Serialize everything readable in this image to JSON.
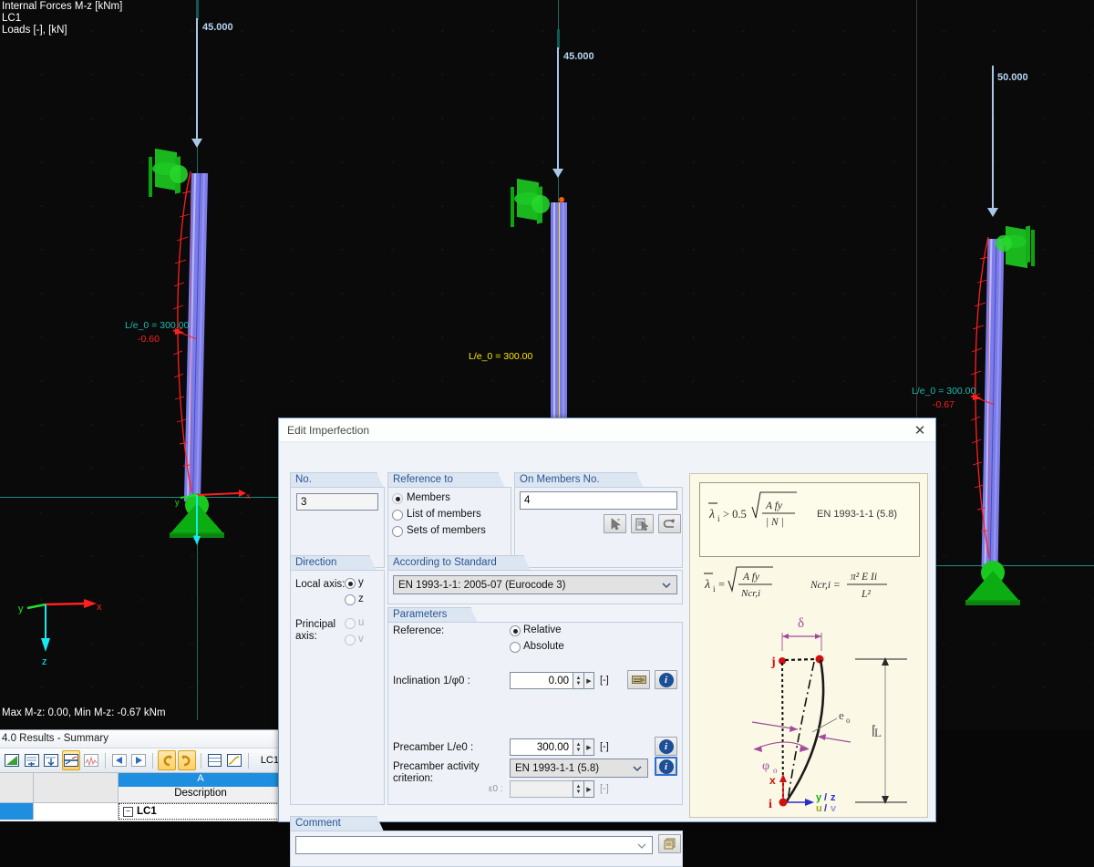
{
  "viewport": {
    "overlay_text_lines": [
      "Internal Forces M-z [kNm]",
      "LC1",
      "Loads [-], [kN]"
    ],
    "status_text": "Max M-z: 0.00, Min M-z: -0.67 kNm",
    "axis_triad": {
      "x": "x",
      "y": "y",
      "z": "z"
    },
    "columns": [
      {
        "load_value": "45.000",
        "precamber_label": "L/e_0 = 300.00",
        "moment_label": "-0.60",
        "label_color": "#1fb9b0"
      },
      {
        "load_value": "45.000",
        "precamber_label": "L/e_0 = 300.00",
        "moment_label": "",
        "label_color": "#ffe500"
      },
      {
        "load_value": "50.000",
        "precamber_label": "L/e_0 = 300.00",
        "moment_label": "-0.67",
        "label_color": "#1fb9b0"
      }
    ]
  },
  "results_panel": {
    "title": "4.0 Results - Summary",
    "toolbar_buttons": [
      {
        "name": "results-table-icon",
        "pressed": false
      },
      {
        "name": "filter-icon",
        "pressed": false
      },
      {
        "name": "import-icon",
        "pressed": false
      },
      {
        "name": "diagram-icon",
        "pressed": true
      },
      {
        "name": "chart-icon",
        "pressed": false
      },
      {
        "name": "prev-icon",
        "pressed": false
      },
      {
        "name": "next-icon",
        "pressed": false
      },
      {
        "name": "rotate-left-icon",
        "pressed": true
      },
      {
        "name": "rotate-right-icon",
        "pressed": true
      },
      {
        "name": "grid-icon",
        "pressed": false
      },
      {
        "name": "edit-icon",
        "pressed": false
      }
    ],
    "load_case": "LC1",
    "column_letter": "A",
    "column_header": "Description",
    "rows": [
      {
        "description": "LC1",
        "expander": "−"
      }
    ]
  },
  "dialog": {
    "title": "Edit Imperfection",
    "close_label": "✕",
    "no_group": {
      "title": "No.",
      "value": "3"
    },
    "reference_to": {
      "title": "Reference to",
      "options": [
        "Members",
        "List of members",
        "Sets of members"
      ],
      "selected": "Members"
    },
    "on_members": {
      "title": "On Members No.",
      "value": "4",
      "buttons": [
        "pick-single-icon",
        "pick-list-icon",
        "select-all-icon"
      ]
    },
    "direction": {
      "title": "Direction",
      "local_axis_label": "Local axis:",
      "local_axis_options": [
        "y",
        "z"
      ],
      "local_axis_selected": "y",
      "principal_axis_label": "Principal axis:",
      "principal_axis_options": [
        "u",
        "v"
      ],
      "principal_axis_selected": ""
    },
    "standard": {
      "title": "According to Standard",
      "value": "EN 1993-1-1: 2005-07  (Eurocode 3)"
    },
    "parameters": {
      "title": "Parameters",
      "reference_label": "Reference:",
      "reference_options": [
        "Relative",
        "Absolute"
      ],
      "reference_selected": "Relative",
      "inclination_label": "Inclination 1/φ0 :",
      "inclination_value": "0.00",
      "inclination_unit": "[-]",
      "precamber_label": "Precamber L/e0 :",
      "precamber_value": "300.00",
      "precamber_unit": "[-]",
      "criterion_label_line1": "Precamber activity",
      "criterion_label_line2": "criterion:",
      "criterion_value": "EN 1993-1-1 (5.8)",
      "epsilon_label": "ε0 :",
      "epsilon_value": "",
      "epsilon_unit": "[-]"
    },
    "comment": {
      "title": "Comment",
      "value": "",
      "placeholder": ""
    },
    "figure": {
      "formula_1": "λ̄i > 0.5",
      "formula_1_num": "A fy",
      "formula_1_den": "| N |",
      "formula_1_ref": "EN 1993-1-1 (5.8)",
      "formula_2": "λ̄i =",
      "formula_2_num": "A fy",
      "formula_2_den": "Ncr,i",
      "formula_3": "Ncr,i =",
      "formula_3_num": "π² E Ii",
      "formula_3_den": "L²",
      "diagram_labels": {
        "delta": "δ",
        "node_j": "j",
        "node_i": "i",
        "e0": "e₀",
        "phi0": "φ₀",
        "length": "L",
        "axis_x": "x",
        "axis_yz": "y / z",
        "axis_uv": "u / v"
      }
    }
  },
  "colors": {
    "accent_blue": "#1e8fe0",
    "member_purple": "#7b7ce8",
    "support_green": "#18bf1e",
    "moment_red": "#ff2020",
    "label_teal": "#1fb9b0",
    "label_yellow": "#ffe500",
    "figure_bg": "#fbf8e6"
  }
}
